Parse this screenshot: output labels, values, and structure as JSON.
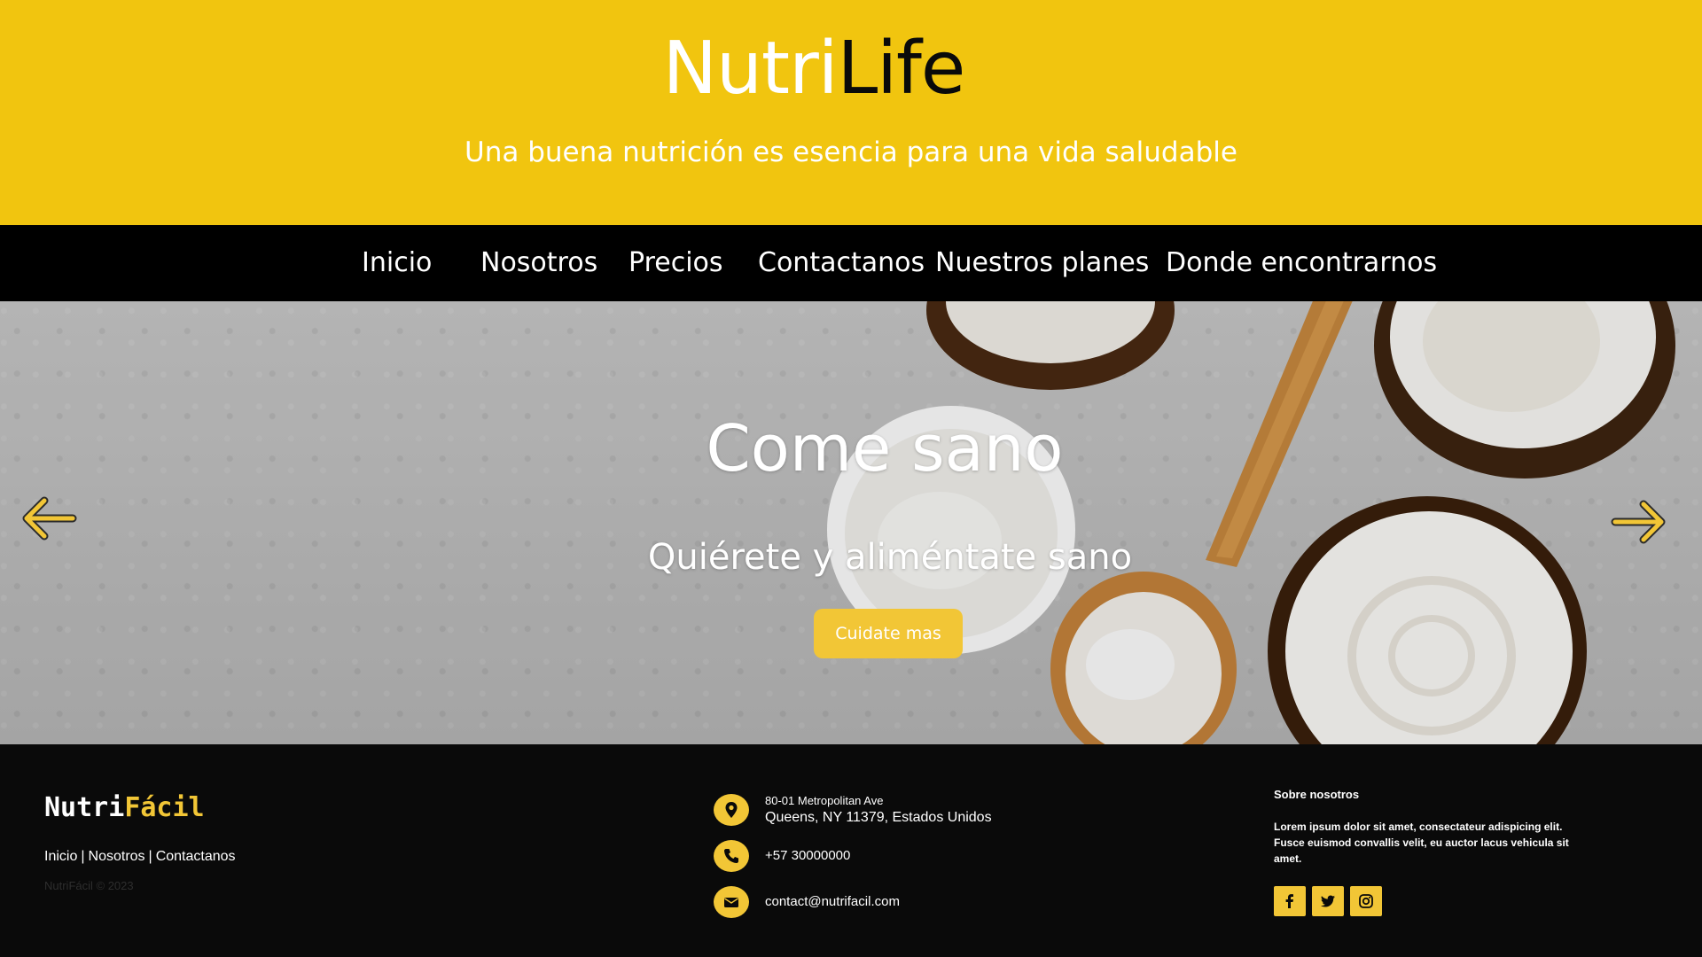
{
  "header": {
    "brand_part1": "Nutri",
    "brand_part2": "Life",
    "tagline": "Una buena nutrición es esencia para una vida saludable"
  },
  "nav": {
    "items": [
      {
        "label": "Inicio"
      },
      {
        "label": "Nosotros"
      },
      {
        "label": "Precios"
      },
      {
        "label": "Contactanos"
      },
      {
        "label": "Nuestros planes"
      },
      {
        "label": "Donde encontrarnos"
      }
    ]
  },
  "hero": {
    "title": "Come sano",
    "subtitle": "Quiérete y aliméntate sano",
    "button_label": "Cuidate mas",
    "prev_icon": "arrow-left-icon",
    "next_icon": "arrow-right-icon"
  },
  "footer": {
    "logo_part1": "Nutri",
    "logo_part2": "Fácil",
    "links": [
      {
        "label": "Inicio"
      },
      {
        "label": "Nosotros"
      },
      {
        "label": "Contactanos"
      }
    ],
    "separator": "|",
    "copyright": "NutriFácil © 2023",
    "contact": {
      "address_line1": "80-01 Metropolitan Ave",
      "address_line2": "Queens, NY 11379, Estados Unidos",
      "phone": "+57 30000000",
      "email": "contact@nutrifacil.com"
    },
    "about": {
      "title": "Sobre nosotros",
      "text": "Lorem ipsum dolor sit amet, consectateur adispicing elit. Fusce euismod convallis velit, eu auctor lacus vehicula sit amet."
    },
    "socials": [
      {
        "icon": "facebook-icon"
      },
      {
        "icon": "twitter-icon"
      },
      {
        "icon": "instagram-icon"
      }
    ]
  },
  "colors": {
    "brand_yellow": "#f1c50f",
    "accent_yellow": "#f2c636",
    "nav_black": "#000000",
    "footer_black": "#0a0a0a"
  }
}
